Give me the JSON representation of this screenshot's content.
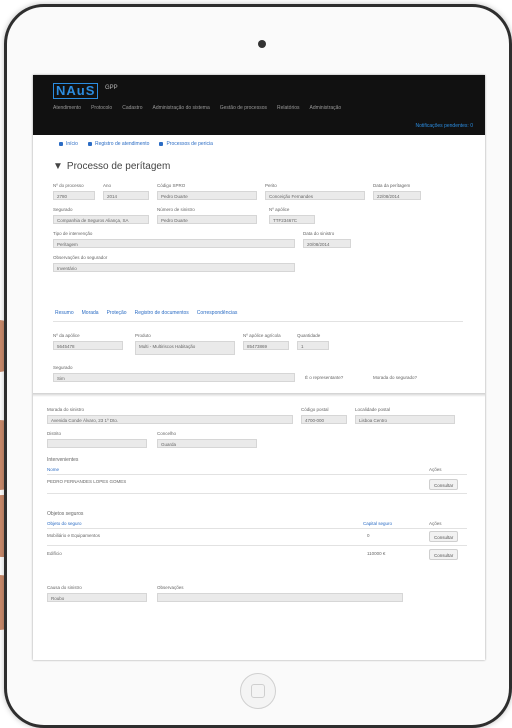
{
  "navbar": {
    "logo": "NAuS",
    "logo_sub": "GPP",
    "items": [
      "Atendimento",
      "Protocolo",
      "Cadastro",
      "Administração do sistema",
      "Gestão de processos",
      "Relatórios",
      "Administração"
    ],
    "right_text": "Notificações pendentes: 0"
  },
  "breadcrumbs": [
    "Início",
    "Registro de atendimento",
    "Processos de pericia"
  ],
  "page": {
    "title": "Processo de perítagem"
  },
  "form_top": {
    "n_processo": {
      "label": "Nº do processo",
      "value": "2780"
    },
    "ano": {
      "label": "Ano",
      "value": "2014"
    },
    "codigo": {
      "label": "Código SPRO",
      "value": "Pedro Duarte"
    },
    "perito": {
      "label": "Perito",
      "value": "Conceição Fernandes"
    },
    "data": {
      "label": "Data da perítagem",
      "value": "22/08/2014"
    },
    "segurado": {
      "label": "Segurado",
      "value": "Companhia de Seguros Aliança, SA"
    },
    "sinistro": {
      "label": "Número de sinistro",
      "value": "Pedro Duarte"
    },
    "n_apolice": {
      "label": "Nº apólice",
      "value": "TTF23467C"
    },
    "tipo": {
      "label": "Tipo de intervenção",
      "value": "Perítagem"
    },
    "data_sinistro": {
      "label": "Data do sinistro",
      "value": "20/08/2014"
    },
    "obs": {
      "label": "Observações do segurador",
      "value": "Inventário"
    }
  },
  "tabs": [
    "Resumo",
    "Morada",
    "Proteção",
    "Registro de documentos",
    "Correspondências"
  ],
  "form_mid": {
    "n_apolice2": {
      "label": "Nº da apólice",
      "value": "5645478"
    },
    "produto": {
      "label": "Produto",
      "value": "Multi - Multiriscos Habitação"
    },
    "n_apolice3": {
      "label": "Nº apólice agrícola",
      "value": "85473869"
    },
    "quantidade": {
      "label": "Quantidade",
      "value": "1"
    },
    "seguro": {
      "label": "Segurado",
      "value": "Sim"
    },
    "opt1": "É o representante?",
    "opt2": "Morada do segurado?"
  },
  "form_low": {
    "morada": {
      "label": "Morada do sinistro",
      "value": "Avenida Conde Álvaro, 23 1º Dto."
    },
    "cod_postal": {
      "label": "Código postal",
      "value": "4700-000"
    },
    "localidade": {
      "label": "Localidade postal",
      "value": "Lisboa Centro"
    },
    "distrito": {
      "label": "Distrito",
      "value": ""
    },
    "concelho": {
      "label": "Concelho",
      "value": "Guarda"
    },
    "intervenientes_title": "Intervenientes",
    "nome_header": "Nome",
    "acoes_header": "Ações",
    "interveniente": "PEDRO FERNANDES LOPES GOMES",
    "consultar": "Consultar",
    "objetos_title": "Objetos seguros",
    "obj_header": "Objeto do seguro",
    "capital_header": "Capital seguro",
    "objetos": [
      {
        "name": "Mobiliário e Equipamentos",
        "value": "0"
      },
      {
        "name": "Edifício",
        "value": "110000 €"
      }
    ],
    "causa": {
      "label": "Causa do sinistro",
      "value": "Roubo"
    },
    "observacoes": {
      "label": "Observações",
      "value": ""
    }
  }
}
